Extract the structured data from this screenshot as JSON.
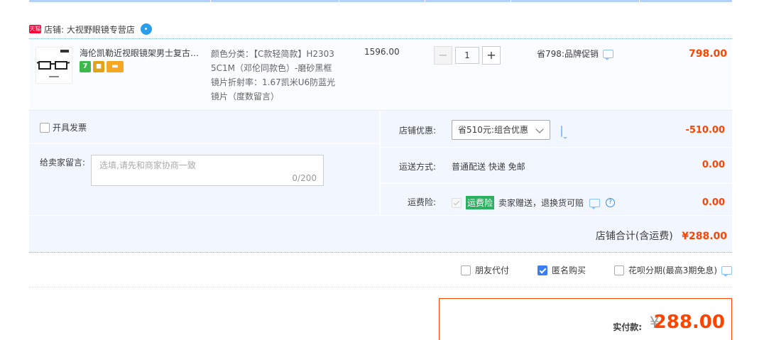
{
  "shop": {
    "tmall_badge": "天猫",
    "name": "店铺: 大视野眼镜专营店"
  },
  "item": {
    "title": "海伦凯勒近视眼镜架男士复古商务方框",
    "sku_lines": [
      "颜色分类：【C款轻简款】H2303",
      "5C1M（邓伦同款色）-磨砂黑框",
      "镜片折射率：1.67凯米U6防蓝光",
      "镜片（度数留言）"
    ],
    "badge_7": "7",
    "unit_price": "1596.00",
    "quantity": "1",
    "qty_minus": "−",
    "qty_plus": "+",
    "promotion": "省798:品牌促销",
    "subtotal": "798.00"
  },
  "invoice": {
    "label": "开具发票"
  },
  "message": {
    "label": "给卖家留言:",
    "placeholder": "选填,请先和商家协商一致",
    "counter": "0/200"
  },
  "discount": {
    "label": "店铺优惠:",
    "selected": "省510元:组合优惠",
    "value": "-510.00"
  },
  "shipping": {
    "label": "运送方式:",
    "method": "普通配送 快递 免邮",
    "value": "0.00"
  },
  "insurance": {
    "label": "运费险:",
    "tag": "运费险",
    "desc": "卖家赠送，退换货可赔",
    "help": "?",
    "value": "0.00"
  },
  "shop_total": {
    "label": "店铺合计(含运费)",
    "value": "¥288.00"
  },
  "options": {
    "friend_pay": "朋友代付",
    "anonymous": "匿名购买",
    "huabei": "花呗分期(最高3期免息)"
  },
  "payment": {
    "label": "实付款:",
    "currency": "¥",
    "amount": "288.00"
  },
  "colors": {
    "accent_red": "#ff4400",
    "blue_line": "#b2d1ff",
    "panel_bg": "#f2f7ff",
    "checkbox_blue": "#3a7ef5",
    "insurance_green": "#2eb062"
  }
}
